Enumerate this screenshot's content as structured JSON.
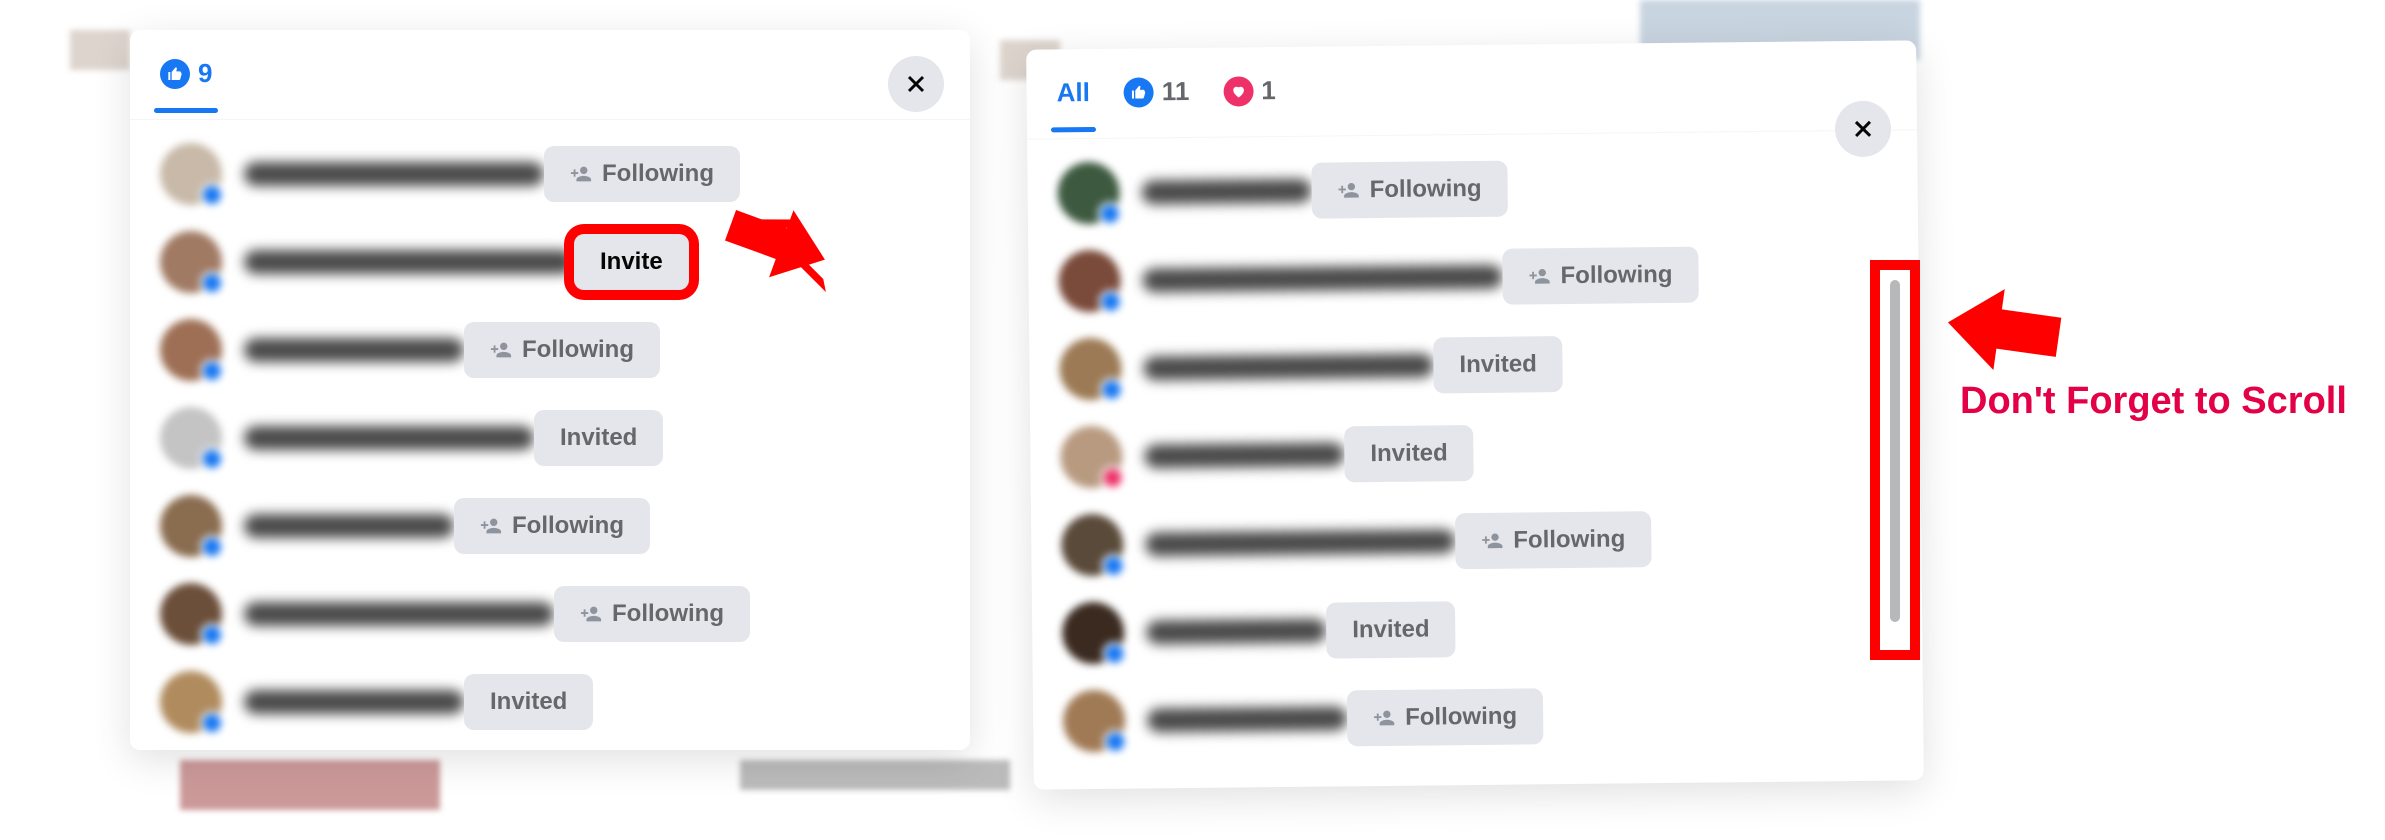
{
  "left_panel": {
    "tabs": [
      {
        "icon": "like",
        "count": "9",
        "active": true
      }
    ],
    "close": "x",
    "rows": [
      {
        "avatar_color": "#c8b9a8",
        "name_w": 300,
        "btn_type": "following",
        "btn_label": "Following"
      },
      {
        "avatar_color": "#a07a63",
        "name_w": 330,
        "btn_type": "invite",
        "btn_label": "Invite",
        "highlight": true
      },
      {
        "avatar_color": "#9e6f55",
        "name_w": 220,
        "btn_type": "following",
        "btn_label": "Following"
      },
      {
        "avatar_color": "#c4c4c4",
        "name_w": 290,
        "btn_type": "invited",
        "btn_label": "Invited"
      },
      {
        "avatar_color": "#8a6c4f",
        "name_w": 210,
        "btn_type": "following",
        "btn_label": "Following"
      },
      {
        "avatar_color": "#6b4f3a",
        "name_w": 310,
        "btn_type": "following",
        "btn_label": "Following"
      },
      {
        "avatar_color": "#b08b5e",
        "name_w": 220,
        "btn_type": "invited",
        "btn_label": "Invited"
      }
    ]
  },
  "right_panel": {
    "tabs": [
      {
        "text": "All",
        "active": true
      },
      {
        "icon": "like",
        "count": "11"
      },
      {
        "icon": "heart",
        "count": "1"
      }
    ],
    "close": "x",
    "rows": [
      {
        "avatar_color": "#3d5a40",
        "name_w": 170,
        "btn_type": "following",
        "btn_label": "Following"
      },
      {
        "avatar_color": "#7a4a3a",
        "name_w": 360,
        "btn_type": "following",
        "btn_label": "Following"
      },
      {
        "avatar_color": "#9c7a55",
        "name_w": 290,
        "btn_type": "invited",
        "btn_label": "Invited"
      },
      {
        "avatar_color": "#b89a80",
        "name_w": 200,
        "btn_type": "invited",
        "btn_label": "Invited",
        "badge": "red"
      },
      {
        "avatar_color": "#5a4a3a",
        "name_w": 310,
        "btn_type": "following",
        "btn_label": "Following"
      },
      {
        "avatar_color": "#3a2a20",
        "name_w": 180,
        "btn_type": "invited",
        "btn_label": "Invited"
      },
      {
        "avatar_color": "#a07a55",
        "name_w": 200,
        "btn_type": "following",
        "btn_label": "Following"
      }
    ]
  },
  "annotation": {
    "scroll_text": "Don't Forget to Scroll"
  }
}
